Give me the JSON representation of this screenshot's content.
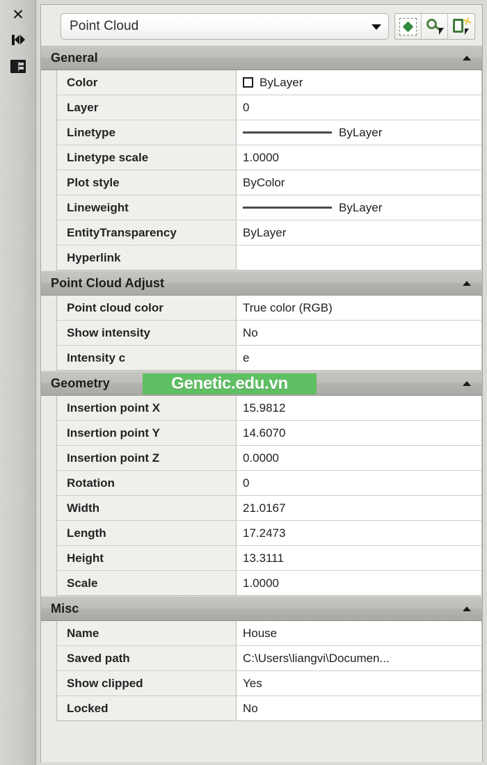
{
  "side_toolbar": {
    "close_icon": "close-icon",
    "autohide_icon": "auto-hide-arrows-icon",
    "panel_menu_icon": "properties-panel-icon"
  },
  "header": {
    "object_type": "Point Cloud",
    "dropdown_icon": "chevron-down-icon",
    "buttons": [
      {
        "name": "select-objects-button",
        "icon": "select-objects-icon"
      },
      {
        "name": "quick-select-button",
        "icon": "quick-select-icon"
      },
      {
        "name": "quick-properties-button",
        "icon": "quick-properties-icon"
      }
    ]
  },
  "colors": {
    "section_header_bg": "#bdbdb9",
    "label_cell_bg": "#efefec",
    "value_cell_bg": "#ffffff",
    "watermark_bg": "#5fbf63",
    "accent_green": "#2e8b3d"
  },
  "sections": [
    {
      "title": "General",
      "collapse_icon": "collapse-triangle-icon",
      "rows": [
        {
          "label": "Color",
          "value": "ByLayer",
          "decoration": "swatch"
        },
        {
          "label": "Layer",
          "value": "0",
          "decoration": "none"
        },
        {
          "label": "Linetype",
          "value": "ByLayer",
          "decoration": "line"
        },
        {
          "label": "Linetype scale",
          "value": "1.0000",
          "decoration": "none"
        },
        {
          "label": "Plot style",
          "value": "ByColor",
          "decoration": "none"
        },
        {
          "label": "Lineweight",
          "value": "ByLayer",
          "decoration": "line"
        },
        {
          "label": "EntityTransparency",
          "value": "ByLayer",
          "decoration": "none"
        },
        {
          "label": "Hyperlink",
          "value": "",
          "decoration": "none"
        }
      ]
    },
    {
      "title": "Point Cloud Adjust",
      "collapse_icon": "collapse-triangle-icon",
      "rows": [
        {
          "label": "Point cloud color",
          "value": "True color (RGB)",
          "decoration": "none"
        },
        {
          "label": "Show intensity",
          "value": "No",
          "decoration": "none"
        },
        {
          "label": "Intensity c",
          "value": "e",
          "decoration": "none"
        }
      ]
    },
    {
      "title": "Geometry",
      "collapse_icon": "collapse-triangle-icon",
      "rows": [
        {
          "label": "Insertion point X",
          "value": "15.9812",
          "decoration": "none"
        },
        {
          "label": "Insertion point Y",
          "value": "14.6070",
          "decoration": "none"
        },
        {
          "label": "Insertion point Z",
          "value": "0.0000",
          "decoration": "none"
        },
        {
          "label": "Rotation",
          "value": "0",
          "decoration": "none"
        },
        {
          "label": "Width",
          "value": "21.0167",
          "decoration": "none"
        },
        {
          "label": "Length",
          "value": "17.2473",
          "decoration": "none"
        },
        {
          "label": "Height",
          "value": "13.3111",
          "decoration": "none"
        },
        {
          "label": "Scale",
          "value": "1.0000",
          "decoration": "none"
        }
      ]
    },
    {
      "title": "Misc",
      "collapse_icon": "collapse-triangle-icon",
      "rows": [
        {
          "label": "Name",
          "value": "House",
          "decoration": "none"
        },
        {
          "label": "Saved path",
          "value": "C:\\Users\\liangvi\\Documen...",
          "decoration": "none"
        },
        {
          "label": "Show clipped",
          "value": "Yes",
          "decoration": "none"
        },
        {
          "label": "Locked",
          "value": "No",
          "decoration": "none"
        }
      ]
    }
  ],
  "watermark": {
    "text": "Genetic.edu.vn"
  }
}
